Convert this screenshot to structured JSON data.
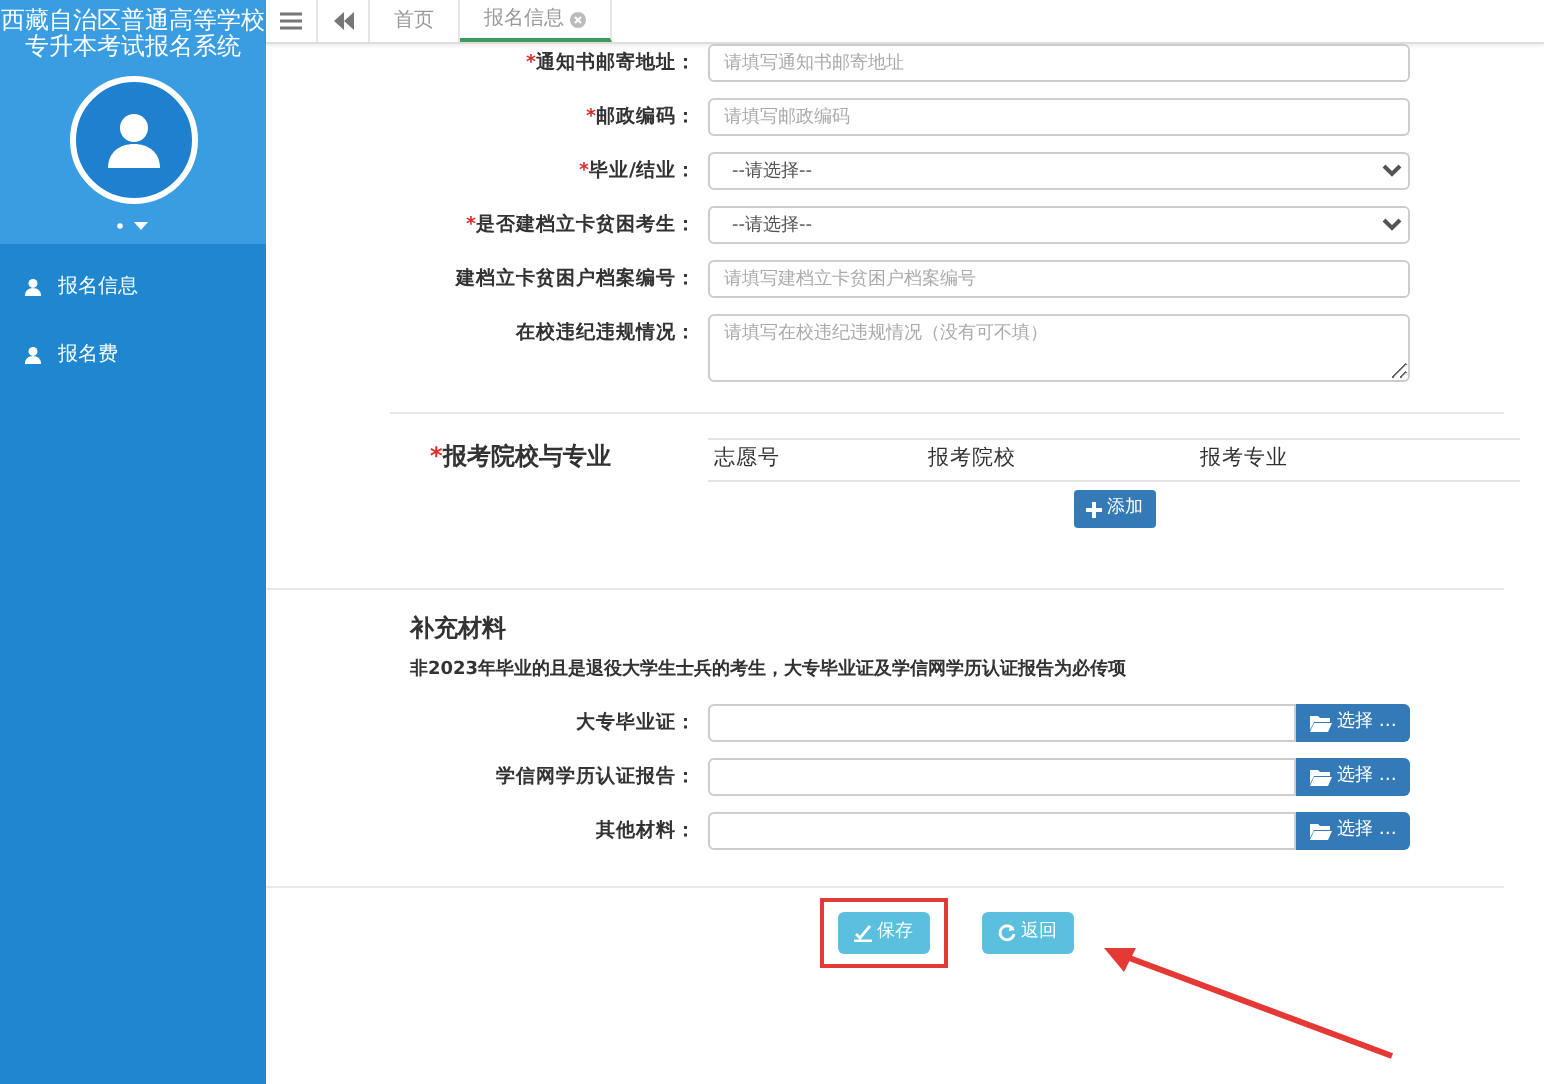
{
  "sidebar": {
    "title_lines": [
      "西藏自治区普通高等学校",
      "专升本考试报名系统"
    ],
    "nav_items": [
      {
        "label": "报名信息",
        "selected": false
      },
      {
        "label": "报名费",
        "selected": false
      }
    ]
  },
  "tabs": [
    {
      "label": "首页",
      "selected": false,
      "closable": false
    },
    {
      "label": "报名信息",
      "selected": true,
      "closable": true
    }
  ],
  "form_fields": [
    {
      "kind": "input",
      "mark": "*",
      "label": "通知书邮寄地址：",
      "placeholder": "请填写通知书邮寄地址"
    },
    {
      "kind": "input",
      "mark": "*",
      "label": "邮政编码：",
      "placeholder": "请填写邮政编码"
    },
    {
      "kind": "select",
      "mark": "*",
      "label": "毕业/结业：",
      "value": "--请选择--"
    },
    {
      "kind": "select",
      "mark": "*",
      "label": "是否建档立卡贫困考生：",
      "value": "--请选择--"
    },
    {
      "kind": "input",
      "label": "建档立卡贫困户档案编号：",
      "placeholder": "请填写建档立卡贫困户档案编号"
    },
    {
      "kind": "textarea",
      "label": "在校违纪违规情况：",
      "placeholder": "请填写在校违纪违规情况（没有可不填）"
    }
  ],
  "schools": {
    "mark": "*",
    "title": "报考院校与专业",
    "columns": [
      "志愿号",
      "报考院校",
      "报考专业"
    ],
    "add_button": "添加"
  },
  "materials": {
    "title": "补充材料",
    "note": "非2023年毕业的且是退役大学生士兵的考生，大专毕业证及学信网学历认证报告为必传项",
    "files": [
      {
        "label": "大专毕业证：",
        "button": "选择 …"
      },
      {
        "label": "学信网学历认证报告：",
        "button": "选择 …"
      },
      {
        "label": "其他材料：",
        "button": "选择 …"
      }
    ]
  },
  "actions": [
    {
      "kind": "save",
      "label": "保存",
      "highlighted": true
    },
    {
      "kind": "back",
      "label": "返回",
      "highlighted": false
    }
  ],
  "annotation_arrow": true
}
